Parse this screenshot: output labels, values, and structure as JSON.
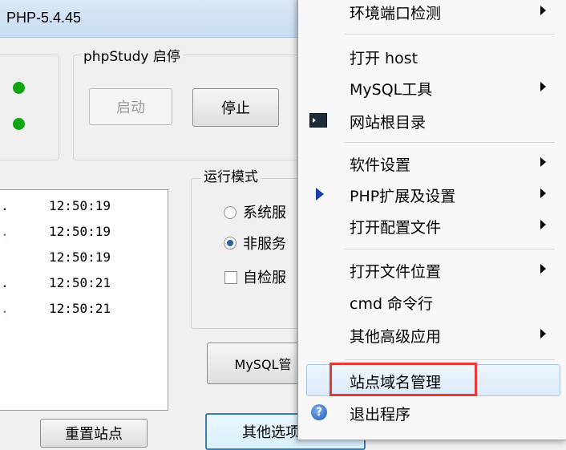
{
  "window": {
    "title": "PHP-5.4.45"
  },
  "control": {
    "group_title": "phpStudy 启停",
    "start_label": "启动",
    "stop_label": "停止"
  },
  "log": {
    "rows": [
      {
        "prefix": ".",
        "time": "12:50:19"
      },
      {
        "prefix": ".",
        "time": "12:50:19"
      },
      {
        "prefix": "",
        "time": "12:50:19"
      },
      {
        "prefix": ".",
        "time": "12:50:21"
      },
      {
        "prefix": ".",
        "time": "12:50:21"
      }
    ]
  },
  "mode": {
    "group_title": "运行模式",
    "system_service_label": "系统服",
    "non_service_label": "非服务",
    "self_check_label": "自检服"
  },
  "buttons": {
    "mysql_label": "MySQL管",
    "reset_site_label": "重置站点",
    "other_options_label": "其他选项菜单"
  },
  "menu": {
    "items": [
      {
        "label": "环境端口检测",
        "submenu": true
      },
      {
        "label": "打开 host",
        "submenu": false
      },
      {
        "label": "MySQL工具",
        "submenu": true
      },
      {
        "label": "网站根目录",
        "submenu": false,
        "icon": "cmd-icon"
      },
      {
        "label": "软件设置",
        "submenu": true
      },
      {
        "label": "PHP扩展及设置",
        "submenu": true,
        "icon": "blue-arrow-icon"
      },
      {
        "label": "打开配置文件",
        "submenu": true
      },
      {
        "label": "打开文件位置",
        "submenu": true
      },
      {
        "label": "cmd 命令行",
        "submenu": false
      },
      {
        "label": "其他高级应用",
        "submenu": true
      },
      {
        "label": "站点域名管理",
        "submenu": false,
        "highlighted": true
      },
      {
        "label": "退出程序",
        "submenu": false,
        "icon": "help-icon"
      }
    ]
  },
  "colors": {
    "status_green": "#11a611",
    "highlight_red": "#e53935",
    "hover_blue": "#dceaf9"
  }
}
